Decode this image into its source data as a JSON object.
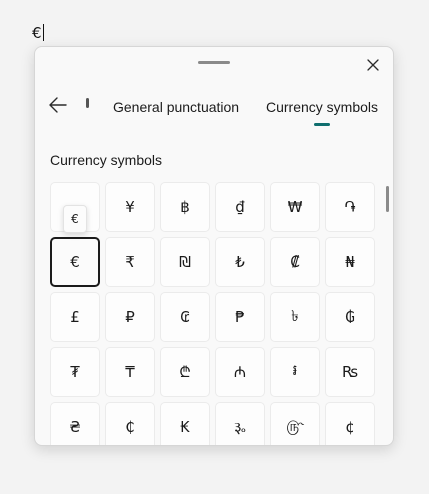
{
  "input": {
    "text": "€"
  },
  "panel": {
    "tabs": [
      "General punctuation",
      "Currency symbols"
    ],
    "active_tab": "Currency symbols",
    "section_title": "Currency symbols",
    "tooltip": "€",
    "accent_color": "#0f6e6e",
    "symbols": [
      [
        "",
        "¥",
        "฿",
        "₫",
        "₩",
        "֏"
      ],
      [
        "€",
        "₹",
        "₪",
        "₺",
        "₡",
        "₦"
      ],
      [
        "£",
        "₽",
        "₢",
        "₱",
        "৳",
        "₲"
      ],
      [
        "₮",
        "₸",
        "₾",
        "₼",
        "៛",
        "₨"
      ],
      [
        "₴",
        "₵",
        "₭",
        "૱",
        "௹",
        "¢"
      ]
    ]
  }
}
